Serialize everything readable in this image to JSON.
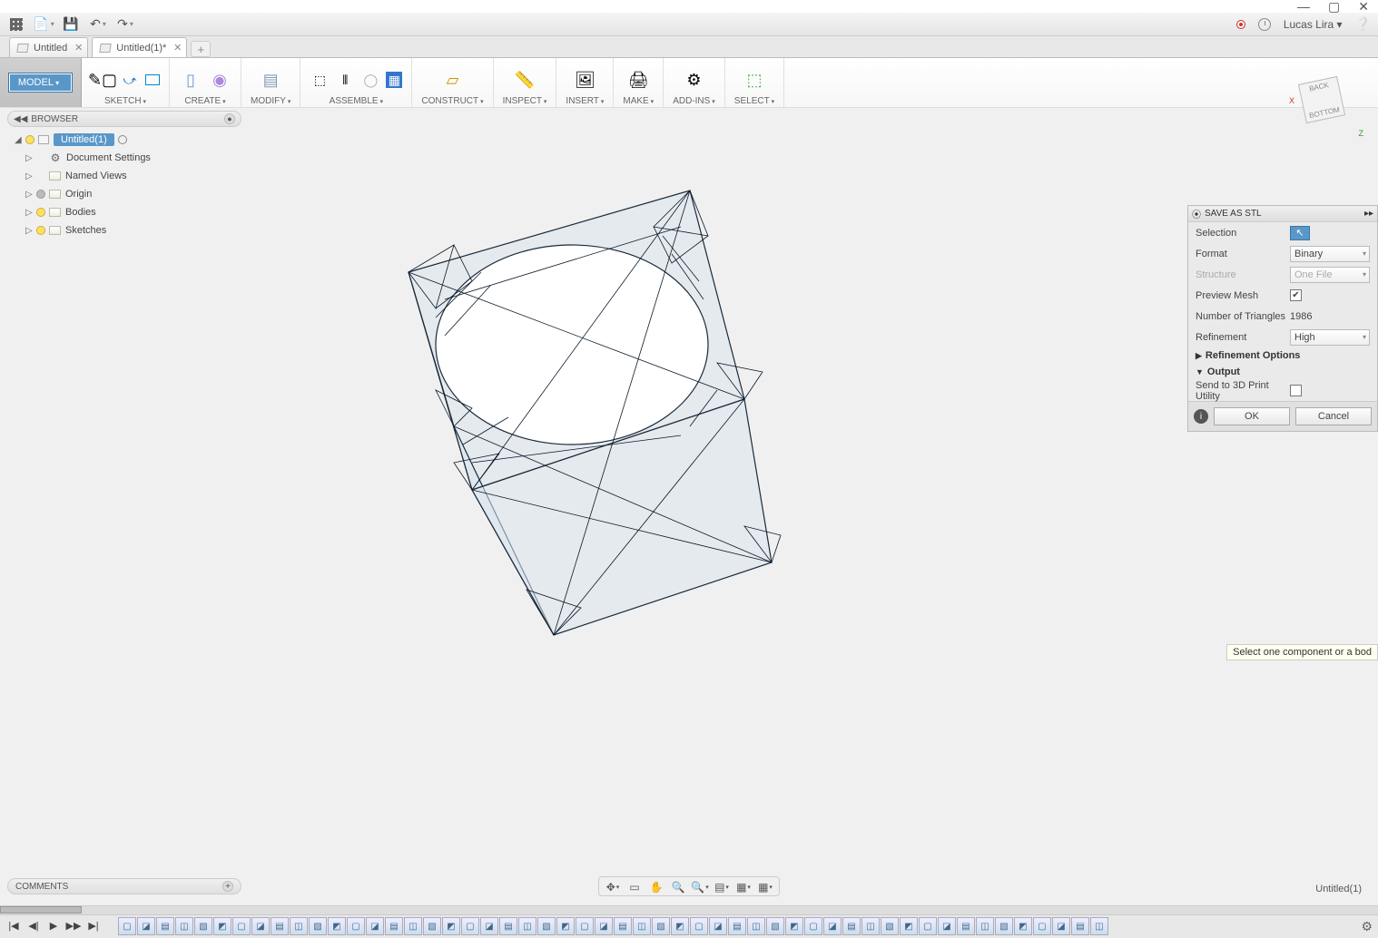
{
  "window": {
    "user": "Lucas Lira"
  },
  "tabs": [
    {
      "label": "Untitled",
      "active": false
    },
    {
      "label": "Untitled(1)*",
      "active": true
    }
  ],
  "workspace_button": "MODEL",
  "ribbon_groups": [
    {
      "label": "SKETCH"
    },
    {
      "label": "CREATE"
    },
    {
      "label": "MODIFY"
    },
    {
      "label": "ASSEMBLE"
    },
    {
      "label": "CONSTRUCT"
    },
    {
      "label": "INSPECT"
    },
    {
      "label": "INSERT"
    },
    {
      "label": "MAKE"
    },
    {
      "label": "ADD-INS"
    },
    {
      "label": "SELECT"
    }
  ],
  "browser": {
    "title": "BROWSER",
    "root": "Untitled(1)",
    "items": [
      {
        "label": "Document Settings",
        "icon": "gear"
      },
      {
        "label": "Named Views",
        "icon": "folder"
      },
      {
        "label": "Origin",
        "icon": "folder",
        "bulb": "gray"
      },
      {
        "label": "Bodies",
        "icon": "folder",
        "bulb": "on"
      },
      {
        "label": "Sketches",
        "icon": "folder",
        "bulb": "on"
      }
    ]
  },
  "viewcube": {
    "face_top": "BACK",
    "face_bottom": "BOTTOM",
    "x": "X",
    "z": "Z"
  },
  "stl": {
    "title": "SAVE AS STL",
    "rows": {
      "selection_label": "Selection",
      "format_label": "Format",
      "format_value": "Binary",
      "structure_label": "Structure",
      "structure_value": "One File",
      "preview_label": "Preview Mesh",
      "preview_checked": true,
      "tri_label": "Number of Triangles",
      "tri_value": "1986",
      "refine_label": "Refinement",
      "refine_value": "High"
    },
    "section_refine": "Refinement Options",
    "section_output": "Output",
    "send3d_label": "Send to 3D Print Utility",
    "ok": "OK",
    "cancel": "Cancel"
  },
  "tooltip": "Select one component or a bod",
  "comments": {
    "title": "COMMENTS"
  },
  "docname": "Untitled(1)",
  "timeline": {
    "op_count": 52
  }
}
